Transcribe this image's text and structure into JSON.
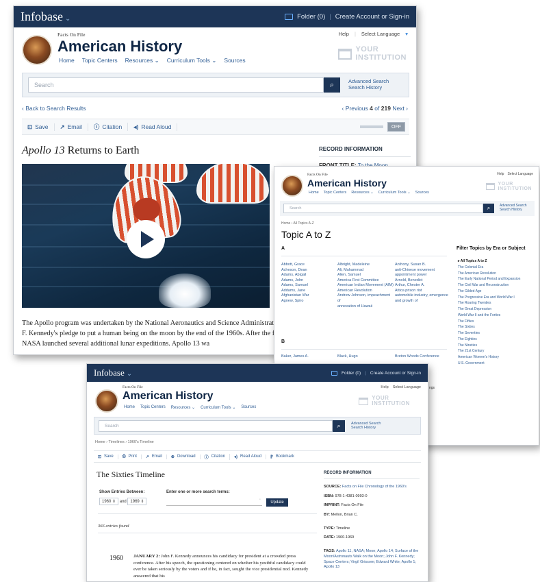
{
  "common": {
    "brand": "Infobase",
    "brand_chevron": "⌄",
    "folder_label": "Folder (0)",
    "account_label": "Create Account or Sign-in",
    "help_label": "Help",
    "language_label": "Select Language",
    "imprint_label": "Facts On File",
    "site_title": "American History",
    "nav": [
      "Home",
      "Topic Centers",
      "Resources ⌄",
      "Curriculum Tools ⌄",
      "Sources"
    ],
    "institution_line1": "YOUR",
    "institution_line2": "INSTITUTION",
    "search_placeholder": "Search",
    "advanced_search": "Advanced Search",
    "search_history": "Search History"
  },
  "shot1": {
    "back_link": "Back to Search Results",
    "pager_prev": "Previous",
    "pager_current": "4",
    "pager_of": "of",
    "pager_total": "219",
    "pager_next": "Next",
    "tools": [
      {
        "icon": "save-icon",
        "label": "Save"
      },
      {
        "icon": "email-icon",
        "label": "Email"
      },
      {
        "icon": "citation-icon",
        "label": "Citation"
      },
      {
        "icon": "read-aloud-icon",
        "label": "Read Aloud"
      }
    ],
    "toggle_label": "OFF",
    "title_italic": "Apollo 13",
    "title_rest": " Returns to Earth",
    "record_info": "RECORD INFORMATION",
    "front_title_label": "FRONT TITLE:",
    "front_title_value": "To the Moon",
    "body": "The Apollo program was undertaken by the National Aeronautics and Science Administration (NASA) in order to fulfill President John F. Kennedy's pledge to put a human being on the moon by the end of the 1960s. After the first lunar landing of the Apollo 11 spacecraft, NASA launched several additional lunar expeditions. Apollo 13 wa"
  },
  "shot2": {
    "breadcrumb": "Home › All Topics A-Z",
    "page_title": "Topic A to Z",
    "letter_a": "A",
    "letter_b": "B",
    "col1": [
      "Abbott, Grace",
      "Acheson, Dean",
      "Adams, Abigail",
      "Adams, John",
      "Adams, Samuel",
      "Addams, Jane",
      "Afghanistan War",
      "Agnew, Spiro"
    ],
    "col2": [
      "Albright, Madeleine",
      "Ali, Muhammad",
      "Alien, Samuel",
      "America First Committee",
      "American Indian Movement (AIM)",
      "American Revolution",
      "Andrew Johnson, impeachment of",
      "annexation of Hawaii"
    ],
    "col3": [
      "Anthony, Susan B.",
      "anti-Chinese movement",
      "appointment power",
      "Arnold, Benedict",
      "Arthur, Chester A.",
      "Attica prison riot",
      "automobile industry, emergence and growth of"
    ],
    "b_row": [
      "Baker, James A.",
      "Black, Hugo",
      "Breton Woods Conference"
    ],
    "filter_title": "Filter Topics by Era or Subject",
    "filters": [
      "All Topics A to Z",
      "The Colonial Era",
      "The American Revolution",
      "The Early National Period and Expansion",
      "The Civil War and Reconstruction",
      "The Gilded Age",
      "The Progressive Era and World War I",
      "The Roaring Twenties",
      "The Great Depression",
      "World War II and the Forties",
      "The Fifties",
      "The Sixties",
      "The Seventies",
      "The Eighties",
      "The Nineties",
      "The 21st Century",
      "American Women's History",
      "U.S. Government"
    ]
  },
  "shot3": {
    "breadcrumb": "Home › Timelines › 1960's Timeline",
    "tools": [
      {
        "icon": "save-icon",
        "label": "Save"
      },
      {
        "icon": "print-icon",
        "label": "Print"
      },
      {
        "icon": "email-icon",
        "label": "Email"
      },
      {
        "icon": "download-icon",
        "label": "Download"
      },
      {
        "icon": "citation-icon",
        "label": "Citation"
      },
      {
        "icon": "read-aloud-icon",
        "label": "Read Aloud"
      },
      {
        "icon": "bookmark-icon",
        "label": "Bookmark"
      }
    ],
    "page_title": "The Sixties Timeline",
    "show_between": "Show Entries Between:",
    "year_from": "1960",
    "and_label": "and",
    "year_to": "1969",
    "terms_label": "Enter one or more search terms:",
    "update_label": "Update",
    "entries_found": "366 entries found",
    "entry_year": "1960",
    "entry_lead": "JANUARY 2:",
    "entry_text": " John F. Kennedy announces his candidacy for president at a crowded press conference. After his speech, the questioning centered on whether his youthful candidacy could ever be taken seriously by the voters and if he, in fact, sought the vice presidential nod. Kennedy answered that his",
    "record_info": "RECORD INFORMATION",
    "fields": [
      {
        "label": "SOURCE:",
        "value": "Facts on File Chronology of the 1960's"
      },
      {
        "label": "ISBN:",
        "value": "978-1-4381-0993-0"
      },
      {
        "label": "IMPRINT:",
        "value": "Facts On File"
      },
      {
        "label": "BY:",
        "value": "Mellon, Brian C."
      },
      {
        "label": "TYPE:",
        "value": "Timeline"
      },
      {
        "label": "DATE:",
        "value": "1960-1969"
      },
      {
        "label": "TAGS:",
        "value": "Apollo 11, NASA; Moon; Apollo 14; Surface of the Moon/Astronauts Walk on the Moon; John F. Kennedy; Space Centers; Virgil Grissom; Edward White; Apollo 1; Apollo 13"
      }
    ],
    "background_fragment": "ngs"
  }
}
